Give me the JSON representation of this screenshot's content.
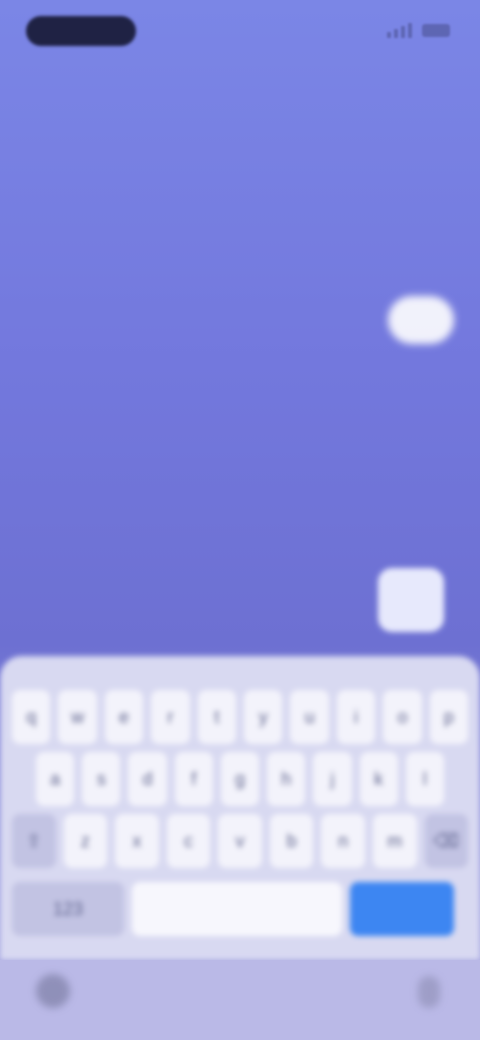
{
  "status_bar": {
    "pill_icon": "dynamic-island-icon",
    "signal_icon": "signal-icon",
    "battery_icon": "battery-icon"
  },
  "header": {
    "line1": "",
    "line2": ""
  },
  "chat": {
    "center_label": "",
    "bubble_icon": "message-bubble-icon",
    "send_icon": "send-icon"
  },
  "keyboard": {
    "row1": [
      "q",
      "w",
      "e",
      "r",
      "t",
      "y",
      "u",
      "i",
      "o",
      "p"
    ],
    "row2": [
      "a",
      "s",
      "d",
      "f",
      "g",
      "h",
      "j",
      "k",
      "l"
    ],
    "row3": [
      "⇧",
      "z",
      "x",
      "c",
      "v",
      "b",
      "n",
      "m",
      "⌫"
    ],
    "mode_label": "123",
    "space_label": "",
    "go_label": ""
  },
  "bottom_bar": {
    "emoji_icon": "emoji-icon",
    "mic_icon": "microphone-icon"
  },
  "colors": {
    "accent": "#3d86f2",
    "background_top": "#7b86e6",
    "background_bottom": "#6d70d2"
  }
}
